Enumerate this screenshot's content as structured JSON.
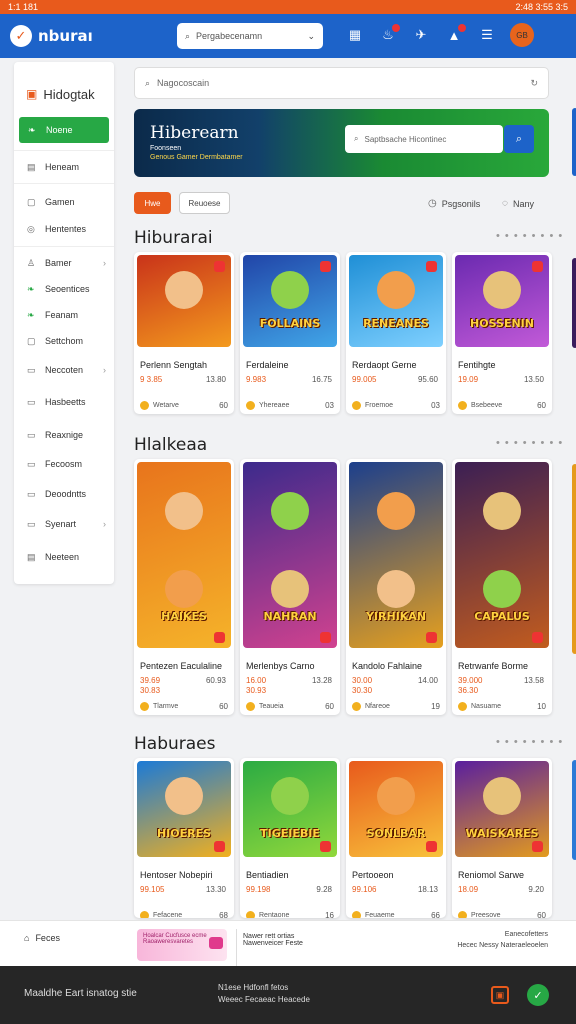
{
  "status": {
    "time": "1:1 181",
    "right": "2:48 3:55 3:5"
  },
  "topbar": {
    "brand": "nburaı",
    "search_placeholder": "Pergabecenamn",
    "avatar_label": "GB"
  },
  "sidebar": {
    "brand": "Hidogtak",
    "items": [
      {
        "label": "Noene",
        "icon": "leaf-icon"
      },
      {
        "label": "Heneam",
        "icon": "grid-icon"
      },
      {
        "label": "Gamen",
        "icon": "game-icon"
      },
      {
        "label": "Hententes",
        "icon": "circle-icon"
      },
      {
        "label": "Bamer",
        "icon": "person-icon"
      },
      {
        "label": "Seoentices",
        "icon": "leaf-icon"
      },
      {
        "label": "Feanam",
        "icon": "leaf-icon"
      },
      {
        "label": "Settchom",
        "icon": "box-icon"
      },
      {
        "label": "Neccoten",
        "icon": "doc-icon"
      },
      {
        "label": "Hasbeetts",
        "icon": "doc-icon"
      },
      {
        "label": "Reaxnige",
        "icon": "doc-icon"
      },
      {
        "label": "Fecoosm",
        "icon": "doc-icon"
      },
      {
        "label": "Deoodntts",
        "icon": "doc-icon"
      },
      {
        "label": "Syenart",
        "icon": "doc-icon"
      },
      {
        "label": "Neeteen",
        "icon": "grid-icon"
      }
    ]
  },
  "main_search": {
    "placeholder": "Nagocoscain"
  },
  "banner": {
    "title": "Hiberearn",
    "sub1": "Foonseen",
    "sub2": "Genous Gamer Dermbatamer",
    "search_placeholder": "Saptbsache Hicontinec"
  },
  "chips": {
    "first": "Hwe",
    "second": "Reuoese"
  },
  "right_options": {
    "first": "Psgsonils",
    "second": "Nany"
  },
  "sections": [
    {
      "title": "Hiburarai",
      "dots": "• • • • • • • •",
      "cards": [
        {
          "name": "Perlenn Sengtah",
          "p1": "9 3.85",
          "p2": "13.80",
          "foot": "Wetarve",
          "num": "60"
        },
        {
          "name": "Ferdaleine",
          "p1": "9.983",
          "p2": "16.75",
          "foot": "Yhereaee",
          "num": "03"
        },
        {
          "name": "Rerdaopt Gerne",
          "p1": "99.005",
          "p2": "95.60",
          "foot": "Froemoe",
          "num": "03"
        },
        {
          "name": "Fentihgte",
          "p1": "19.09",
          "p2": "13.50",
          "foot": "Bsebeeve",
          "num": "60"
        }
      ]
    },
    {
      "title": "Hlalkeaa",
      "dots": "• • • • • • • •",
      "cards": [
        {
          "name": "Pentezen Eaculaline",
          "p1": "39.69",
          "p2": "60.93",
          "p3": "30.83",
          "foot": "Tlarmve",
          "num": "60"
        },
        {
          "name": "Merlenbys Carno",
          "p1": "16.00",
          "p2": "13.28",
          "p3": "30.93",
          "foot": "Teaueia",
          "num": "60"
        },
        {
          "name": "Kandolo Fahlaine",
          "p1": "30.00",
          "p2": "14.00",
          "p3": "30.30",
          "foot": "Nfareoe",
          "num": "19"
        },
        {
          "name": "Retrwanfe Borme",
          "p1": "39.000",
          "p2": "13.58",
          "p3": "36.30",
          "foot": "Nasuame",
          "num": "10"
        }
      ]
    },
    {
      "title": "Haburaes",
      "dots": "• • • • • • • •",
      "cards": [
        {
          "name": "Hentoser Nobepiri",
          "p1": "99.105",
          "p2": "13.30",
          "foot": "Fefacene",
          "num": "68"
        },
        {
          "name": "Bentiadien",
          "p1": "99.198",
          "p2": "9.28",
          "foot": "Rentaone",
          "num": "16"
        },
        {
          "name": "Pertooeon",
          "p1": "99.106",
          "p2": "18.13",
          "foot": "Feuaeme",
          "num": "66"
        },
        {
          "name": "Reniomol Sarwe",
          "p1": "18.09",
          "p2": "9.20",
          "foot": "Preesove",
          "num": "60"
        }
      ]
    }
  ],
  "art_titles": [
    [
      "",
      "FOLLAINS",
      "RENEANES",
      "HOSSENIN"
    ],
    [
      "HAIKES",
      "NAHRAN",
      "YIRHIKAN",
      "CAPALUS"
    ],
    [
      "HIOERES",
      "TIGEIEBIE",
      "SONLBAR",
      "WAISKARES"
    ]
  ],
  "footer": {
    "home": "Feces",
    "pink_line1": "Hoalcar Cucfusce ecme",
    "pink_line2": "Raoaweresvaretes",
    "info_line1": "Nawer rett ortias",
    "info_line2": "Nawenveicer Feste",
    "right_line1": "Eanecofetters",
    "right_line2": "Hecec Nessy Nateraeleoelen"
  },
  "bottombar": {
    "left": "Maaldhe Eart isnatog stie",
    "mid1": "N1ese Hdfonfl fetos",
    "mid2": "Weeec Fecaeac Heacede"
  },
  "colors": {
    "accent": "#e85a1c",
    "blue": "#1d63c9",
    "green": "#27a845"
  }
}
